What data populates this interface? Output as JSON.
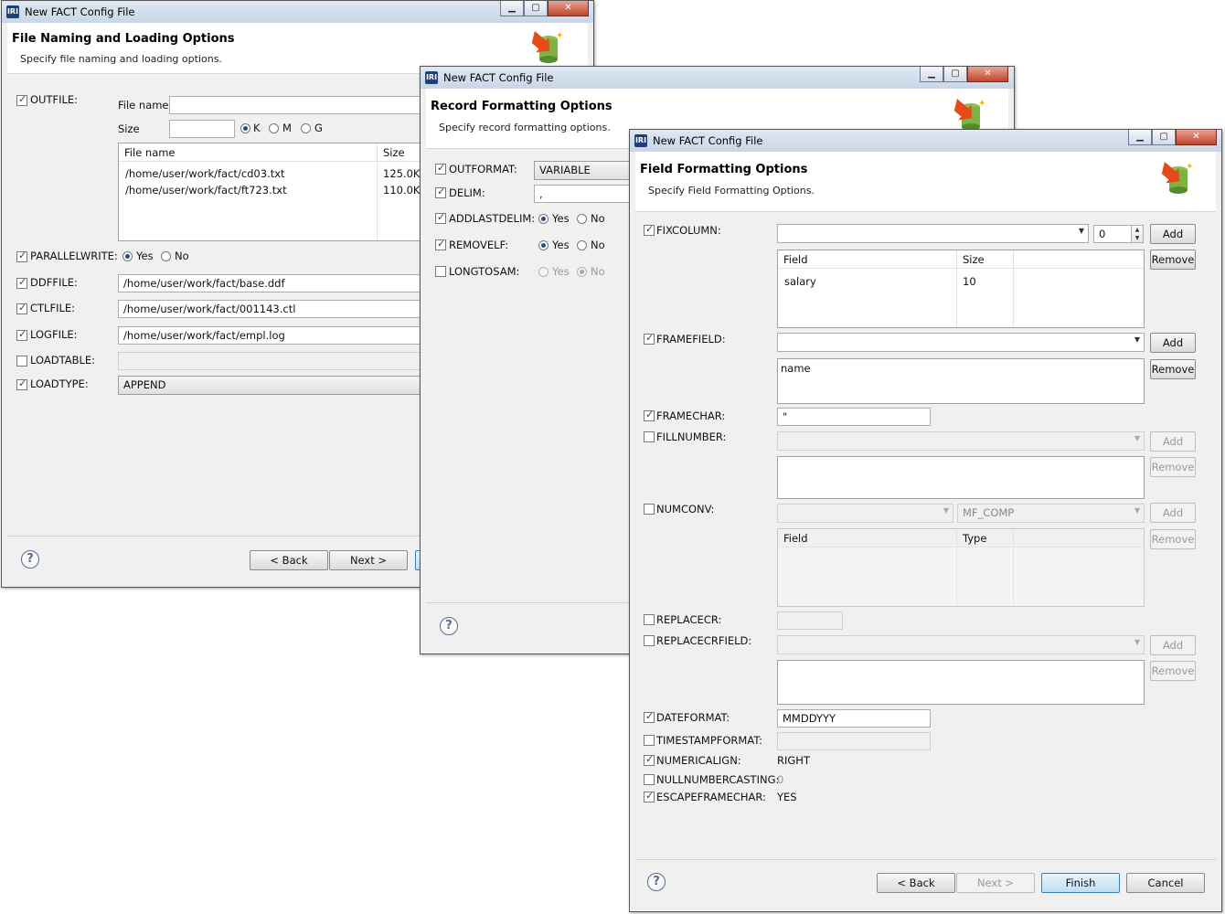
{
  "dialog_title": "New FACT Config File",
  "common": {
    "back": "< Back",
    "next": "Next >",
    "finish": "Finish",
    "cancel": "Cancel",
    "add": "Add",
    "remove": "Remove",
    "yes": "Yes",
    "no": "No",
    "help": "?"
  },
  "win1": {
    "heading": "File Naming and Loading Options",
    "subheading": "Specify file naming and loading options.",
    "outfile_label": "OUTFILE:",
    "file_name_label": "File name:",
    "size_label": "Size",
    "size_units": [
      "K",
      "M",
      "G"
    ],
    "table_headers": [
      "File name",
      "Size"
    ],
    "table_rows": [
      {
        "name": "/home/user/work/fact/cd03.txt",
        "size": "125.0K"
      },
      {
        "name": "/home/user/work/fact/ft723.txt",
        "size": "110.0K"
      }
    ],
    "parallelwrite_label": "PARALLELWRITE:",
    "ddffile_label": "DDFFILE:",
    "ddffile_value": "/home/user/work/fact/base.ddf",
    "ctlfile_label": "CTLFILE:",
    "ctlfile_value": "/home/user/work/fact/001143.ctl",
    "logfile_label": "LOGFILE:",
    "logfile_value": "/home/user/work/fact/empl.log",
    "loadtable_label": "LOADTABLE:",
    "loadtype_label": "LOADTYPE:",
    "loadtype_value": "APPEND"
  },
  "win2": {
    "heading": "Record Formatting Options",
    "subheading": "Specify record formatting options.",
    "outformat_label": "OUTFORMAT:",
    "outformat_value": "VARIABLE",
    "delim_label": "DELIM:",
    "delim_value": ",",
    "addlastdelim_label": "ADDLASTDELIM:",
    "removelf_label": "REMOVELF:",
    "longtosam_label": "LONGTOSAM:"
  },
  "win3": {
    "heading": "Field Formatting Options",
    "subheading": "Specify Field Formatting Options.",
    "fixcolumn_label": "FIXCOLUMN:",
    "fixcolumn_spin_value": "0",
    "fix_table_headers": [
      "Field",
      "Size"
    ],
    "fix_table_rows": [
      {
        "field": "salary",
        "size": "10"
      }
    ],
    "framefield_label": "FRAMEFIELD:",
    "framefield_list": [
      "name"
    ],
    "framechar_label": "FRAMECHAR:",
    "framechar_value": "\"",
    "fillnumber_label": "FILLNUMBER:",
    "numconv_label": "NUMCONV:",
    "numconv_type_value": "MF_COMP",
    "numconv_table_headers": [
      "Field",
      "Type"
    ],
    "replacecr_label": "REPLACECR:",
    "replacecrfield_label": "REPLACECRFIELD:",
    "dateformat_label": "DATEFORMAT:",
    "dateformat_value": "MMDDYYY",
    "timestampformat_label": "TIMESTAMPFORMAT:",
    "numericalign_label": "NUMERICALIGN:",
    "numericalign_value": "RIGHT",
    "nullnumbercasting_label": "NULLNUMBERCASTING:",
    "nullnumbercasting_value": "0",
    "escapeframechar_label": "ESCAPEFRAMECHAR:",
    "escapeframechar_value": "YES"
  }
}
